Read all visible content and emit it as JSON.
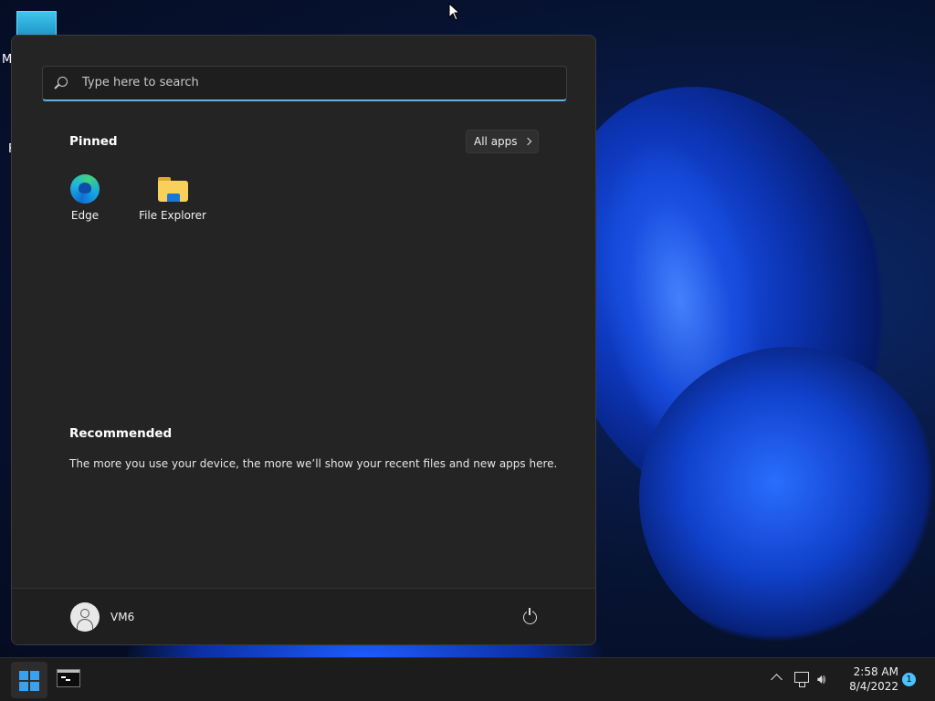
{
  "desktop": {
    "icon_label_1": "M",
    "icon_label_2": "F"
  },
  "start_menu": {
    "search": {
      "placeholder": "Type here to search"
    },
    "pinned": {
      "title": "Pinned",
      "all_apps_label": "All apps",
      "apps": [
        {
          "label": "Edge",
          "icon": "edge-icon"
        },
        {
          "label": "File Explorer",
          "icon": "folder-icon"
        }
      ]
    },
    "recommended": {
      "title": "Recommended",
      "message": "The more you use your device, the more we’ll show your recent files and new apps here."
    },
    "user": {
      "name": "VM6"
    }
  },
  "taskbar": {
    "clock": {
      "time": "2:58 AM",
      "date": "8/4/2022"
    },
    "notification_count": "1"
  },
  "colors": {
    "menu_bg": "#242424",
    "accent": "#4cc2ff",
    "search_underline": "#5fb2e6"
  }
}
